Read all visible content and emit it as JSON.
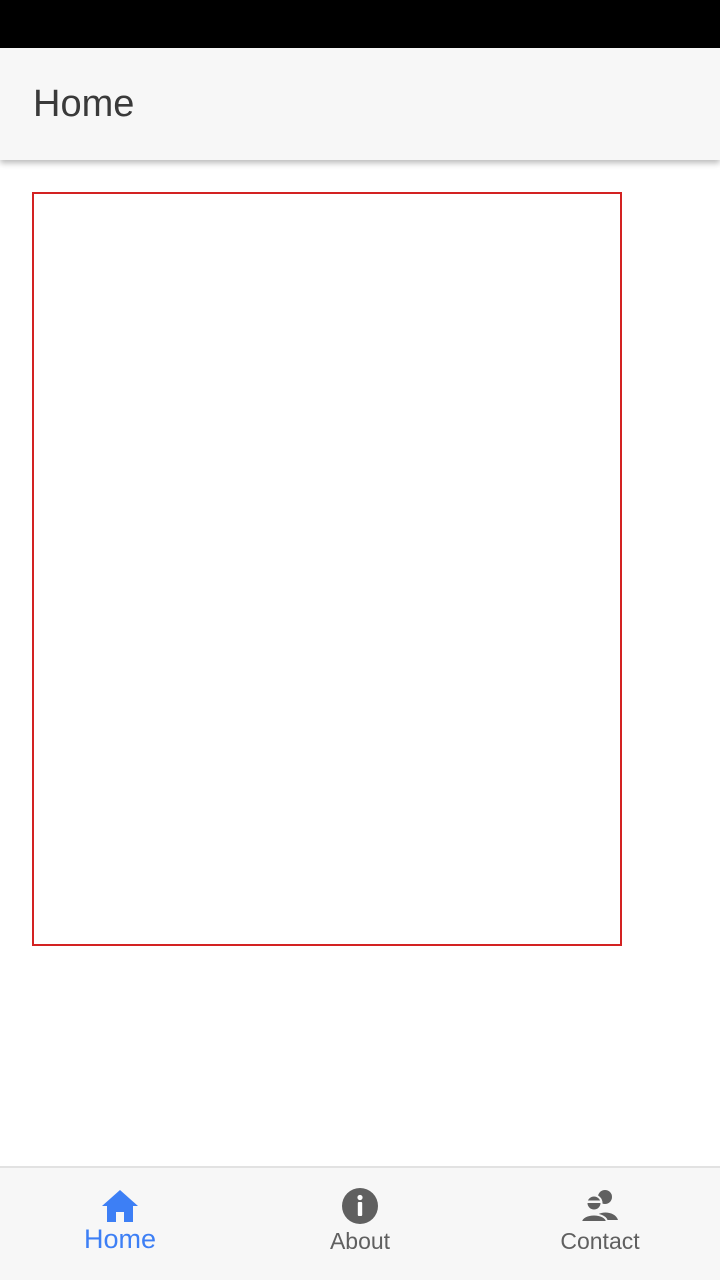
{
  "app_bar": {
    "title": "Home"
  },
  "bottom_nav": {
    "items": [
      {
        "label": "Home",
        "icon": "home-icon",
        "active": true
      },
      {
        "label": "About",
        "icon": "info-icon",
        "active": false
      },
      {
        "label": "Contact",
        "icon": "contacts-icon",
        "active": false
      }
    ]
  },
  "colors": {
    "active": "#3d7ff5",
    "inactive": "#606060",
    "frame_border": "#d32222",
    "status_bar": "#000000",
    "app_bar_bg": "#f7f7f7"
  }
}
